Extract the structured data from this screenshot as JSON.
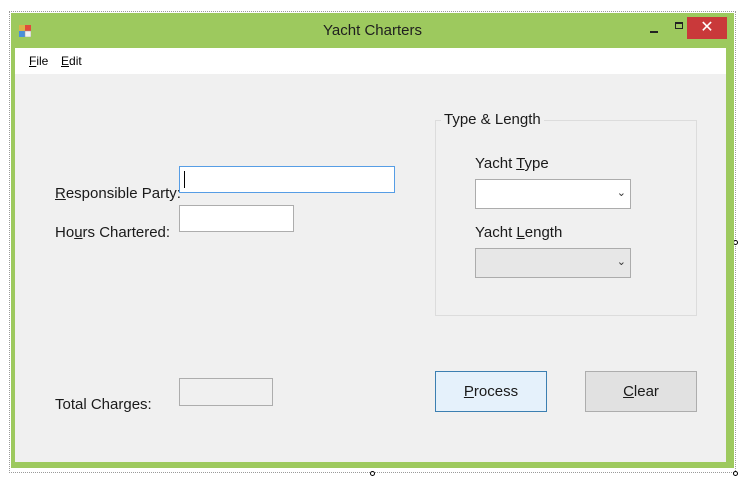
{
  "window": {
    "title": "Yacht Charters"
  },
  "icons": {
    "app": "form-icon",
    "minimize": "minimize-icon",
    "maximize": "maximize-icon",
    "close": "close-icon",
    "dropdown": "chevron-down-icon"
  },
  "menu": {
    "file": {
      "accel": "F",
      "rest": "ile"
    },
    "edit": {
      "accel": "E",
      "rest": "dit"
    }
  },
  "form": {
    "responsible_party": {
      "accel": "R",
      "rest": "esponsible Party:",
      "value": ""
    },
    "hours_chartered": {
      "pre": "Ho",
      "accel": "u",
      "rest": "rs Chartered:",
      "value": ""
    },
    "total_charges": {
      "label": "Total Charges:",
      "value": ""
    }
  },
  "group": {
    "title": "Type & Length",
    "yacht_type": {
      "pre": "Yacht ",
      "accel": "T",
      "rest": "ype",
      "selected": ""
    },
    "yacht_length": {
      "pre": "Yacht ",
      "accel": "L",
      "rest": "ength",
      "selected": ""
    }
  },
  "buttons": {
    "process": {
      "accel": "P",
      "rest": "rocess"
    },
    "clear": {
      "accel": "C",
      "rest": "lear"
    }
  },
  "colors": {
    "frame": "#9dc95e",
    "close_button": "#c9393a",
    "focus_border": "#569de5",
    "client_bg": "#f0f0f0"
  }
}
